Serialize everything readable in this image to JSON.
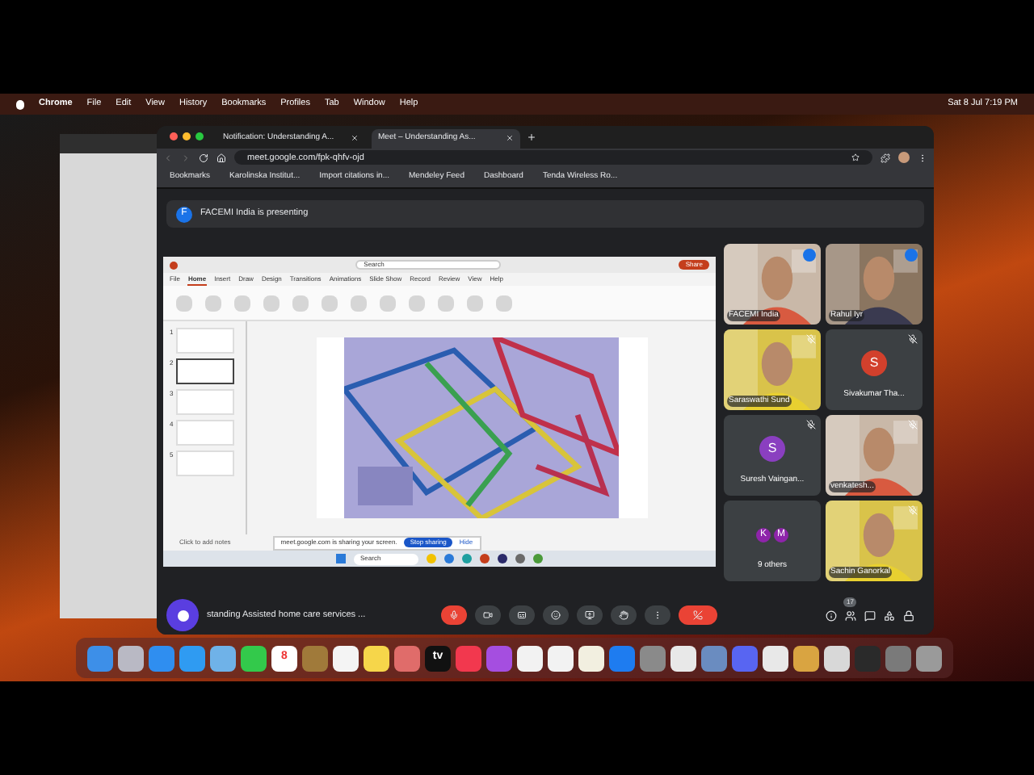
{
  "menu_bar": {
    "app": "Chrome",
    "items": [
      "File",
      "Edit",
      "View",
      "History",
      "Bookmarks",
      "Profiles",
      "Tab",
      "Window",
      "Help"
    ],
    "clock": "Sat 8 Jul  7:19 PM"
  },
  "browser": {
    "tabs": [
      {
        "title": "Notification: Understanding A...",
        "selected": false
      },
      {
        "title": "Meet – Understanding As...",
        "selected": true
      }
    ],
    "address": "meet.google.com/fpk-qhfv-ojd",
    "bookmarks": [
      "Bookmarks",
      "Karolinska Institut...",
      "Import citations in...",
      "Mendeley Feed",
      "Dashboard",
      "Tenda Wireless Ro..."
    ]
  },
  "meet": {
    "banner": {
      "avatar": "F",
      "text": "FACEMI India is presenting"
    },
    "presentation": {
      "ribbon_tabs": [
        {
          "label": "File",
          "selected": false
        },
        {
          "label": "Home",
          "selected": true
        },
        {
          "label": "Insert",
          "selected": false
        },
        {
          "label": "Draw",
          "selected": false
        },
        {
          "label": "Design",
          "selected": false
        },
        {
          "label": "Transitions",
          "selected": false
        },
        {
          "label": "Animations",
          "selected": false
        },
        {
          "label": "Slide Show",
          "selected": false
        },
        {
          "label": "Record",
          "selected": false
        },
        {
          "label": "Review",
          "selected": false
        },
        {
          "label": "View",
          "selected": false
        },
        {
          "label": "Help",
          "selected": false
        }
      ],
      "search": "Search",
      "share_button": "Share",
      "thumbnails": [
        {
          "number": "1",
          "selected": false
        },
        {
          "number": "2",
          "selected": true
        },
        {
          "number": "3",
          "selected": false
        },
        {
          "number": "4",
          "selected": false
        },
        {
          "number": "5",
          "selected": false
        }
      ],
      "notes_placeholder": "Click to add notes",
      "share_notice": {
        "text": "meet.google.com is sharing your screen.",
        "stop": "Stop sharing",
        "hide": "Hide"
      },
      "taskbar_search": "Search"
    },
    "participants": [
      {
        "name": "FACEMI India",
        "kind": "video",
        "muted": false
      },
      {
        "name": "Rahul Iyr",
        "kind": "video",
        "muted": false
      },
      {
        "name": "Saraswathi Sund",
        "kind": "video",
        "muted": true
      },
      {
        "name": "Sivakumar Tha...",
        "kind": "avatar",
        "letters": [
          "S"
        ],
        "color": "#d2402c",
        "muted": true
      },
      {
        "name": "Suresh Vaingan...",
        "kind": "avatar",
        "letters": [
          "S"
        ],
        "color": "#8a3fc0",
        "muted": true
      },
      {
        "name": "venkatesh...",
        "kind": "video",
        "muted": true
      },
      {
        "name": "9 others",
        "kind": "others",
        "letters": [
          "K",
          "M"
        ],
        "color": "#8e24aa"
      },
      {
        "name": "Sachin Ganorkal",
        "kind": "video",
        "muted": true
      }
    ],
    "bottom_bar": {
      "meeting_title": "standing Assisted home care services ...",
      "participant_count": "17"
    }
  },
  "dock": [
    {
      "color": "#3d8fe8"
    },
    {
      "color": "#b9b9c4"
    },
    {
      "color": "#2f8ef0"
    },
    {
      "color": "#2f9bf2"
    },
    {
      "color": "#6fb2e8"
    },
    {
      "color": "#33c94b"
    },
    {
      "color": "#ffffff",
      "label": "8"
    },
    {
      "color": "#a07a3a"
    },
    {
      "color": "#f4f4f4"
    },
    {
      "color": "#f6d64a"
    },
    {
      "color": "#e06c6a"
    },
    {
      "color": "#111111",
      "label": "tv"
    },
    {
      "color": "#f2384e"
    },
    {
      "color": "#a54ee0"
    },
    {
      "color": "#f2f2f2"
    },
    {
      "color": "#f2f2f2"
    },
    {
      "color": "#f2efe0"
    },
    {
      "color": "#1e7cf0"
    },
    {
      "color": "#8a8a8a"
    },
    {
      "color": "#e8e8e8"
    },
    {
      "color": "#6a8cc0"
    },
    {
      "color": "#5865f2"
    },
    {
      "color": "#e8e8e8"
    },
    {
      "color": "#d9a441"
    },
    {
      "color": "#d8d8d8"
    },
    {
      "color": "#2a2a2a"
    },
    {
      "color": "#7a7a7a"
    },
    {
      "color": "#9a9a9a"
    }
  ]
}
